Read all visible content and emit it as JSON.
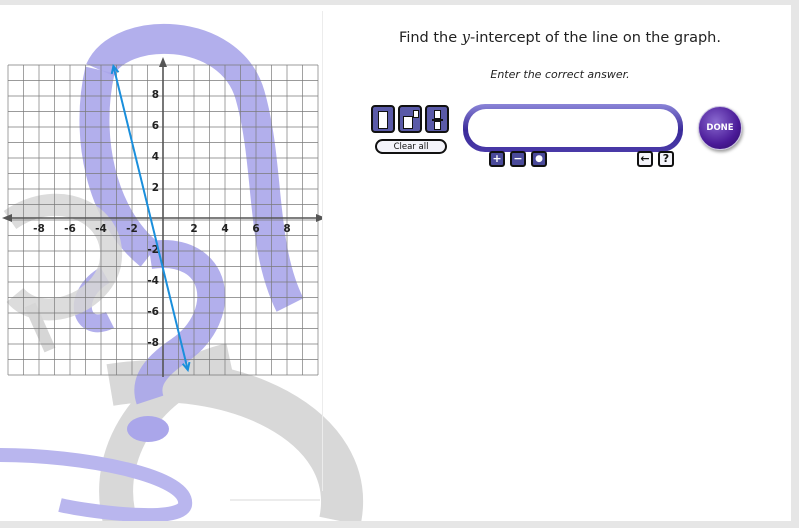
{
  "question": {
    "prefix": "Find the ",
    "variable": "y",
    "suffix": "-intercept of the line on the graph."
  },
  "instruction": "Enter the correct answer.",
  "templates": [
    {
      "icon": "fraction-template-icon"
    },
    {
      "icon": "exponent-template-icon"
    },
    {
      "icon": "mixed-number-template-icon"
    }
  ],
  "clear_all_label": "Clear all",
  "answer": {
    "value": "",
    "placeholder": ""
  },
  "done_label": "DONE",
  "keypad": {
    "plus": "+",
    "minus": "−",
    "dot": "●",
    "back": "←",
    "help": "?"
  },
  "graph": {
    "x_ticks": [
      "-8",
      "-6",
      "-4",
      "-2",
      "2",
      "4",
      "6",
      "8"
    ],
    "y_ticks": [
      "8",
      "6",
      "4",
      "2",
      "-2",
      "-4",
      "-6",
      "-8"
    ],
    "line_color": "#1a8fdc",
    "line_start": [
      -3.2,
      9.8
    ],
    "line_end": [
      1.6,
      -9.8
    ]
  },
  "colors": {
    "accent": "#4a3aa8",
    "deco_purple": "#aaa6ea",
    "deco_gray": "#d6d6d6"
  }
}
